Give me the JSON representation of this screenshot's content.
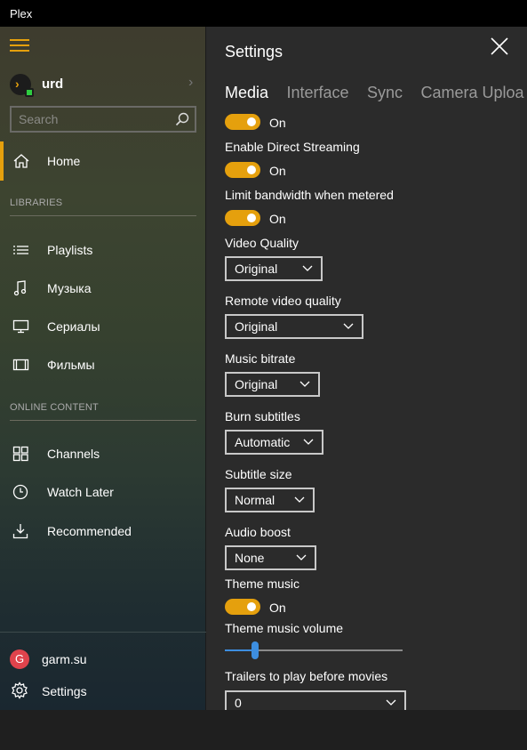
{
  "window": {
    "title": "Plex"
  },
  "sidebar": {
    "user": {
      "name": "urd"
    },
    "search": {
      "placeholder": "Search"
    },
    "home_label": "Home",
    "libraries_header": "LIBRARIES",
    "libraries": [
      {
        "label": "Playlists",
        "icon": "list-icon"
      },
      {
        "label": "Музыка",
        "icon": "music-note-icon"
      },
      {
        "label": "Сериалы",
        "icon": "monitor-icon"
      },
      {
        "label": "Фильмы",
        "icon": "film-icon"
      }
    ],
    "online_header": "ONLINE CONTENT",
    "online": [
      {
        "label": "Channels",
        "icon": "grid-icon"
      },
      {
        "label": "Watch Later",
        "icon": "clock-icon"
      },
      {
        "label": "Recommended",
        "icon": "download-icon"
      }
    ],
    "account": {
      "initial": "G",
      "label": "garm.su"
    },
    "settings_label": "Settings",
    "accent": "#e5a00d"
  },
  "settings": {
    "title": "Settings",
    "tabs": [
      "Media",
      "Interface",
      "Sync",
      "Camera Uploa"
    ],
    "active_tab": "Media",
    "toggle_top": {
      "state": "On"
    },
    "direct_streaming": {
      "label": "Enable Direct Streaming",
      "state": "On"
    },
    "limit_bandwidth": {
      "label": "Limit bandwidth when metered",
      "state": "On"
    },
    "video_quality": {
      "label": "Video Quality",
      "value": "Original"
    },
    "remote_video_quality": {
      "label": "Remote video quality",
      "value": "Original"
    },
    "music_bitrate": {
      "label": "Music bitrate",
      "value": "Original"
    },
    "burn_subtitles": {
      "label": "Burn subtitles",
      "value": "Automatic"
    },
    "subtitle_size": {
      "label": "Subtitle size",
      "value": "Normal"
    },
    "audio_boost": {
      "label": "Audio boost",
      "value": "None"
    },
    "theme_music": {
      "label": "Theme music",
      "state": "On"
    },
    "theme_music_volume": {
      "label": "Theme music volume",
      "value_fraction": 0.17
    },
    "trailers": {
      "label": "Trailers to play before movies",
      "value": "0"
    }
  }
}
